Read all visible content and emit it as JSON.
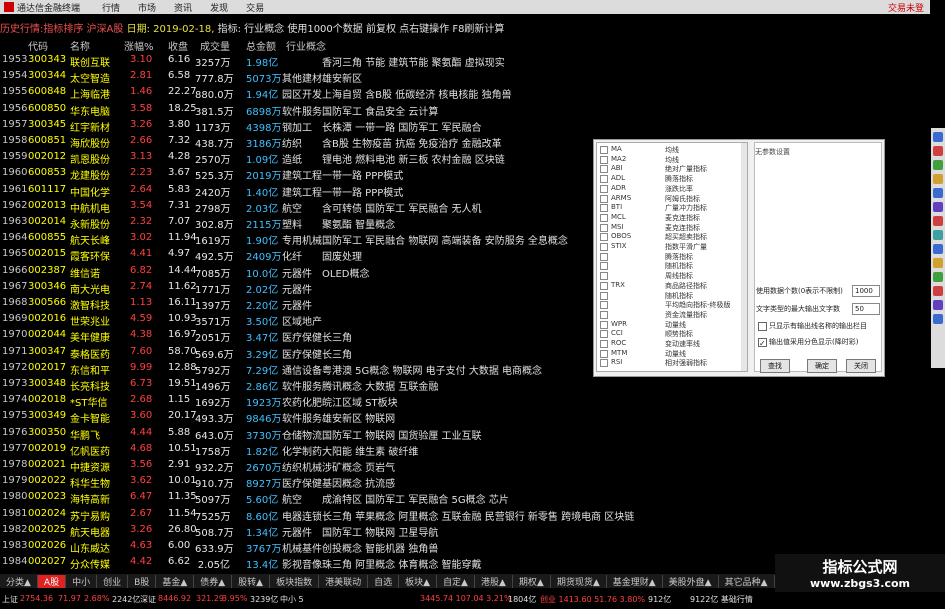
{
  "titlebar": {
    "app": "通达信金融终端",
    "menu": [
      "行情",
      "市场",
      "资讯",
      "发现",
      "交易"
    ],
    "right": "交易未登"
  },
  "histline": {
    "prefix": "历史行情:指标排序 沪深A股",
    "date": "日期: 2019-02-18,",
    "rest": "指标: 行业概念  使用1000个数据 前复权 点右键操作 F8刷新计算"
  },
  "headers": [
    "代码",
    "名称",
    "涨幅%",
    "收盘",
    "成交量",
    "总金额",
    "行业概念"
  ],
  "rows": [
    {
      "no": "1953",
      "code": "300343",
      "name": "联创互联",
      "pct": "3.10",
      "close": "6.16",
      "vol": "3257万",
      "cap": "1.98亿",
      "ind": "",
      "con": "香河三角 节能 建筑节能 聚氨酯 虚拟现实",
      "up": true
    },
    {
      "no": "1954",
      "code": "300344",
      "name": "太空智造",
      "pct": "2.81",
      "close": "6.58",
      "vol": "777.8万",
      "cap": "5073万",
      "ind": "其他建材",
      "con": "雄安新区",
      "up": true
    },
    {
      "no": "1955",
      "code": "600848",
      "name": "上海临港",
      "pct": "1.46",
      "close": "22.27",
      "vol": "880.0万",
      "cap": "1.94亿",
      "ind": "园区开发",
      "con": "上海自贸 含B股 低碳经济 核电核能 独角兽",
      "up": true
    },
    {
      "no": "1956",
      "code": "600850",
      "name": "华东电脑",
      "pct": "3.58",
      "close": "18.25",
      "vol": "381.5万",
      "cap": "6898万",
      "ind": "软件服务",
      "con": "国防军工 食品安全 云计算",
      "up": true
    },
    {
      "no": "1957",
      "code": "300345",
      "name": "红宇新材",
      "pct": "3.26",
      "close": "3.80",
      "vol": "1173万",
      "cap": "4398万",
      "ind": "钢加工",
      "con": "长株潭 一带一路 国防军工 军民融合",
      "up": true
    },
    {
      "no": "1958",
      "code": "600851",
      "name": "海欣股份",
      "pct": "2.66",
      "close": "7.32",
      "vol": "438.7万",
      "cap": "3186万",
      "ind": "纺织",
      "con": "含B股 生物疫苗 抗癌 免疫治疗 金融改革",
      "up": true
    },
    {
      "no": "1959",
      "code": "002012",
      "name": "凯恩股份",
      "pct": "3.13",
      "close": "4.28",
      "vol": "2570万",
      "cap": "1.09亿",
      "ind": "造纸",
      "con": "锂电池 燃料电池 新三板 农村金融 区块链",
      "up": true
    },
    {
      "no": "1960",
      "code": "600853",
      "name": "龙建股份",
      "pct": "2.23",
      "close": "3.67",
      "vol": "525.3万",
      "cap": "2019万",
      "ind": "建筑工程",
      "con": "一带一路 PPP模式",
      "up": true
    },
    {
      "no": "1961",
      "code": "601117",
      "name": "中国化学",
      "pct": "2.64",
      "close": "5.83",
      "vol": "2420万",
      "cap": "1.40亿",
      "ind": "建筑工程",
      "con": "一带一路 PPP模式",
      "up": true
    },
    {
      "no": "1962",
      "code": "002013",
      "name": "中航机电",
      "pct": "3.54",
      "close": "7.31",
      "vol": "2798万",
      "cap": "2.03亿",
      "ind": "航空",
      "con": "含可转债 国防军工 军民融合 无人机",
      "up": true
    },
    {
      "no": "1963",
      "code": "002014",
      "name": "永新股份",
      "pct": "2.32",
      "close": "7.07",
      "vol": "302.8万",
      "cap": "2115万",
      "ind": "塑料",
      "con": "聚氨酯 智量概念",
      "up": true
    },
    {
      "no": "1964",
      "code": "600855",
      "name": "航天长峰",
      "pct": "3.02",
      "close": "11.94",
      "vol": "1619万",
      "cap": "1.90亿",
      "ind": "专用机械",
      "con": "国防军工 军民融合 物联网 高端装备 安防服务 全息概念",
      "up": true
    },
    {
      "no": "1965",
      "code": "002015",
      "name": "霞客环保",
      "pct": "4.41",
      "close": "4.97",
      "vol": "492.5万",
      "cap": "2409万",
      "ind": "化纤",
      "con": "固废处理",
      "up": true
    },
    {
      "no": "1966",
      "code": "002387",
      "name": "维信诺",
      "pct": "6.82",
      "close": "14.44",
      "vol": "7085万",
      "cap": "10.0亿",
      "ind": "元器件",
      "con": "OLED概念",
      "up": true
    },
    {
      "no": "1967",
      "code": "300346",
      "name": "南大光电",
      "pct": "2.74",
      "close": "11.62",
      "vol": "1771万",
      "cap": "2.02亿",
      "ind": "元器件",
      "con": "",
      "up": true
    },
    {
      "no": "1968",
      "code": "300566",
      "name": "激智科技",
      "pct": "1.13",
      "close": "16.11",
      "vol": "1397万",
      "cap": "2.20亿",
      "ind": "元器件",
      "con": "",
      "up": true
    },
    {
      "no": "1969",
      "code": "002016",
      "name": "世荣兆业",
      "pct": "4.59",
      "close": "10.93",
      "vol": "3571万",
      "cap": "3.50亿",
      "ind": "区域地产",
      "con": "",
      "up": true
    },
    {
      "no": "1970",
      "code": "002044",
      "name": "美年健康",
      "pct": "4.38",
      "close": "16.97",
      "vol": "2051万",
      "cap": "3.47亿",
      "ind": "医疗保健",
      "con": "长三角",
      "up": true
    },
    {
      "no": "1971",
      "code": "300347",
      "name": "泰格医药",
      "pct": "7.60",
      "close": "58.70",
      "vol": "569.6万",
      "cap": "3.29亿",
      "ind": "医疗保健",
      "con": "长三角",
      "up": true
    },
    {
      "no": "1972",
      "code": "002017",
      "name": "东信和平",
      "pct": "9.99",
      "close": "12.88",
      "vol": "5792万",
      "cap": "7.29亿",
      "ind": "通信设备",
      "con": "粤港澳 5G概念 物联网 电子支付 大数据 电商概念",
      "up": true
    },
    {
      "no": "1973",
      "code": "300348",
      "name": "长亮科技",
      "pct": "6.73",
      "close": "19.51",
      "vol": "1496万",
      "cap": "2.86亿",
      "ind": "软件服务",
      "con": "腾讯概念 大数据 互联金融",
      "up": true
    },
    {
      "no": "1974",
      "code": "002018",
      "name": "*ST华信",
      "pct": "2.68",
      "close": "1.15",
      "vol": "1692万",
      "cap": "1923万",
      "ind": "农药化肥",
      "con": "皖江区域 ST板块",
      "up": true
    },
    {
      "no": "1975",
      "code": "300349",
      "name": "金卡智能",
      "pct": "3.60",
      "close": "20.17",
      "vol": "493.3万",
      "cap": "9846万",
      "ind": "软件服务",
      "con": "雄安新区 物联网",
      "up": true
    },
    {
      "no": "1976",
      "code": "300350",
      "name": "华鹏飞",
      "pct": "4.44",
      "close": "5.88",
      "vol": "643.0万",
      "cap": "3730万",
      "ind": "仓储物流",
      "con": "国防军工 物联网 国货验厘 工业互联",
      "up": true
    },
    {
      "no": "1977",
      "code": "002019",
      "name": "亿帆医药",
      "pct": "4.68",
      "close": "10.51",
      "vol": "1758万",
      "cap": "1.82亿",
      "ind": "化学制药",
      "con": "大阳能 维生素 破纤维",
      "up": true
    },
    {
      "no": "1978",
      "code": "002021",
      "name": "中捷资源",
      "pct": "3.56",
      "close": "2.91",
      "vol": "932.2万",
      "cap": "2670万",
      "ind": "纺织机械",
      "con": "涉矿概念 页岩气",
      "up": true
    },
    {
      "no": "1979",
      "code": "002022",
      "name": "科华生物",
      "pct": "3.62",
      "close": "10.01",
      "vol": "910.7万",
      "cap": "8927万",
      "ind": "医疗保健",
      "con": "基因概念 抗流感",
      "up": true
    },
    {
      "no": "1980",
      "code": "002023",
      "name": "海特高新",
      "pct": "6.47",
      "close": "11.35",
      "vol": "5097万",
      "cap": "5.60亿",
      "ind": "航空",
      "con": "成渝特区 国防军工 军民融合 5G概念 芯片",
      "up": true
    },
    {
      "no": "1981",
      "code": "002024",
      "name": "苏宁易购",
      "pct": "2.67",
      "close": "11.54",
      "vol": "7525万",
      "cap": "8.60亿",
      "ind": "电器连锁",
      "con": "长三角 苹果概念 阿里概念 互联金融 民营银行 新零售 跨境电商 区块链",
      "up": true
    },
    {
      "no": "1982",
      "code": "002025",
      "name": "航天电器",
      "pct": "3.26",
      "close": "26.80",
      "vol": "508.7万",
      "cap": "1.34亿",
      "ind": "元器件",
      "con": "国防军工 物联网 卫星导航",
      "up": true
    },
    {
      "no": "1983",
      "code": "002026",
      "name": "山东威达",
      "pct": "4.63",
      "close": "6.00",
      "vol": "633.9万",
      "cap": "3767万",
      "ind": "机械基件",
      "con": "创投概念 智能机器 独角兽",
      "up": true
    },
    {
      "no": "1984",
      "code": "002027",
      "name": "分众传媒",
      "pct": "4.42",
      "close": "6.62",
      "vol": "2.05亿",
      "cap": "13.4亿",
      "ind": "影视音像",
      "con": "珠三角 阿里概念 体育概念 智能穿戴",
      "up": true
    }
  ],
  "dialog": {
    "list": [
      [
        "MA",
        "均线"
      ],
      [
        "MA2",
        "均线"
      ],
      [
        "ABI",
        "绝对广量指标"
      ],
      [
        "ADL",
        "腾落指标"
      ],
      [
        "ADR",
        "涨跌比率"
      ],
      [
        "ARMS",
        "阿姆氏指标"
      ],
      [
        "BTI",
        "广量冲力指标"
      ],
      [
        "MCL",
        "麦克连指标"
      ],
      [
        "MSI",
        "麦克连指标"
      ],
      [
        "OBOS",
        "超买超卖指标"
      ],
      [
        "STIX",
        "指数平滑广量"
      ],
      [
        "",
        "腾落指标"
      ],
      [
        "",
        "随机指标"
      ],
      [
        "",
        "周线指标"
      ],
      [
        "TRX",
        "商品路径指标"
      ],
      [
        "",
        "随机指标"
      ],
      [
        "",
        "平均趋向指标-终极版"
      ],
      [
        "",
        "资金流量指标"
      ],
      [
        "WPR",
        "动量线"
      ],
      [
        "CCI",
        "顺势指标"
      ],
      [
        "ROC",
        "变动速率线"
      ],
      [
        "MTM",
        "动量线"
      ],
      [
        "RSI",
        "相对强弱指标"
      ]
    ],
    "note": "无参数设置",
    "field1_label": "使用数据个数(0表示不限制)",
    "field1_value": "1000",
    "field2_label": "文字类型的最大输出文字数",
    "field2_value": "50",
    "check1": "只显示有输出线名称的输出栏目",
    "check2": "输出值采用分色显示(降时彩)",
    "btn_find": "查找",
    "btn_ok": "确定",
    "btn_close": "关闭"
  },
  "tabs": [
    "分类▲",
    "A股",
    "中小",
    "创业",
    "B股",
    "基金▲",
    "债券▲",
    "股转▲",
    "板块指数",
    "港美联动",
    "自选",
    "板块▲",
    "自定▲",
    "港股▲",
    "期权▲",
    "期货现货▲",
    "基金理财▲",
    "美股外盘▲",
    "其它品种▲"
  ],
  "status": {
    "sh_label": "上证",
    "sh_val": "2754.36",
    "sh_chg": "71.97",
    "sh_pct": "2.68%",
    "sh_amt": "2242亿",
    "sz_label": "深证",
    "sz_val": "8446.92",
    "sz_chg": "321.29",
    "sz_pct": "3.95%",
    "sz_amt": "3239亿",
    "mid": "中小 5",
    "cyb": "3445.74 107.04 3.21%",
    "cyb_amt": "1804亿",
    "idx": "创业 1413.60 51.76 3.80%",
    "idx_amt": "912亿",
    "right": "9122亿  基础行情"
  },
  "watermark": {
    "t1": "指标公式网",
    "t2": "www.zbgs3.com"
  },
  "colors": {
    "up": "#ff4040",
    "code": "#ffff00",
    "cap": "#40c0ff",
    "tab_active": "#dd2222"
  }
}
